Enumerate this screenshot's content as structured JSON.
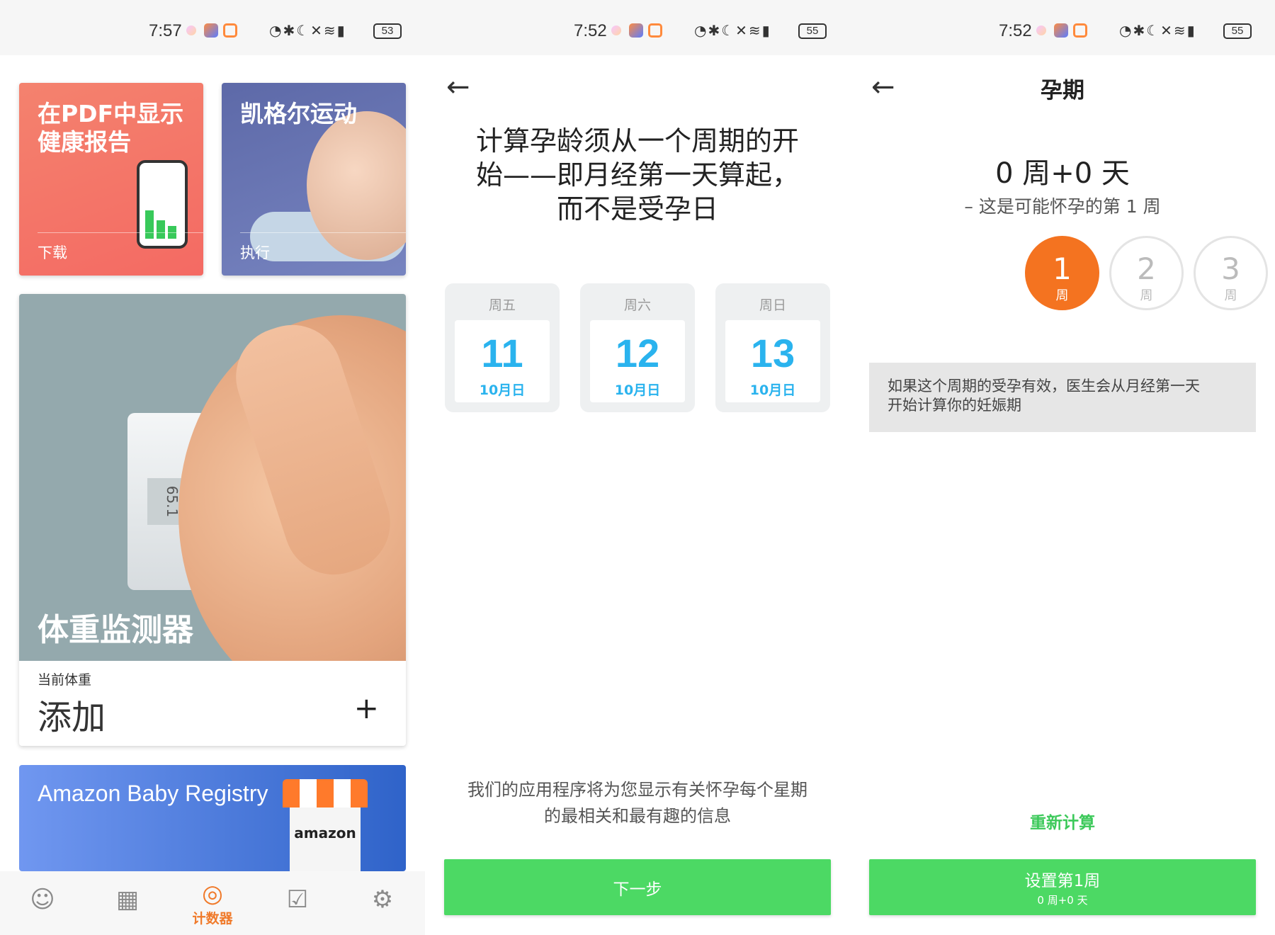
{
  "panel1": {
    "status": {
      "time": "7:57",
      "icons": "◔✱☾✕≋▮",
      "battery": "53"
    },
    "pdf_card": {
      "title": "在PDF中显示\n健康报告",
      "action": "下载"
    },
    "kegel_card": {
      "title": "凯格尔运动",
      "action": "执行"
    },
    "weight_card": {
      "title": "体重监测器",
      "scale_reading": "65.1",
      "current_label": "当前体重",
      "value": "添加",
      "add_symbol": "+"
    },
    "amazon_card": {
      "title": "Amazon Baby Registry",
      "logo": "amazon"
    },
    "tabbar": {
      "tabs": [
        {
          "icon": "baby-face-icon",
          "glyph": "☺"
        },
        {
          "icon": "calendar-icon",
          "glyph": "▦"
        },
        {
          "icon": "counter-icon",
          "glyph": "◎",
          "label": "计数器"
        },
        {
          "icon": "checklist-icon",
          "glyph": "☑"
        },
        {
          "icon": "settings-icon",
          "glyph": "⚙"
        }
      ]
    }
  },
  "panel2": {
    "status": {
      "time": "7:52",
      "icons": "◔✱☾✕≋▮",
      "battery": "55"
    },
    "back": "←",
    "heading": "计算孕龄须从一个周期的开\n始——即月经第一天算起，\n而不是受孕日",
    "days": [
      {
        "weekday": "周五",
        "num": "11",
        "sub": "10月日"
      },
      {
        "weekday": "周六",
        "num": "12",
        "sub": "10月日"
      },
      {
        "weekday": "周日",
        "num": "13",
        "sub": "10月日"
      }
    ],
    "info": "我们的应用程序将为您显示有关怀孕每个星期\n的最相关和最有趣的信息",
    "next_button": "下一步"
  },
  "panel3": {
    "status": {
      "time": "7:52",
      "icons": "◔✱☾✕≋▮",
      "battery": "55"
    },
    "back": "←",
    "title": "孕期",
    "weeks_value": "0 周+0 天",
    "description": "– 这是可能怀孕的第 1 周",
    "week_options": [
      {
        "n": "1",
        "unit": "周",
        "selected": true
      },
      {
        "n": "2",
        "unit": "周",
        "selected": false
      },
      {
        "n": "3",
        "unit": "周",
        "selected": false
      }
    ],
    "note": "如果这个周期的受孕有效，医生会从月经第一天\n开始计算你的妊娠期",
    "recalculate": "重新计算",
    "set_button": {
      "main": "设置第1周",
      "sub": "0 周+0 天"
    }
  },
  "colors": {
    "accent_green": "#4cd964",
    "accent_orange": "#f47320",
    "date_blue": "#2ab3ee"
  }
}
